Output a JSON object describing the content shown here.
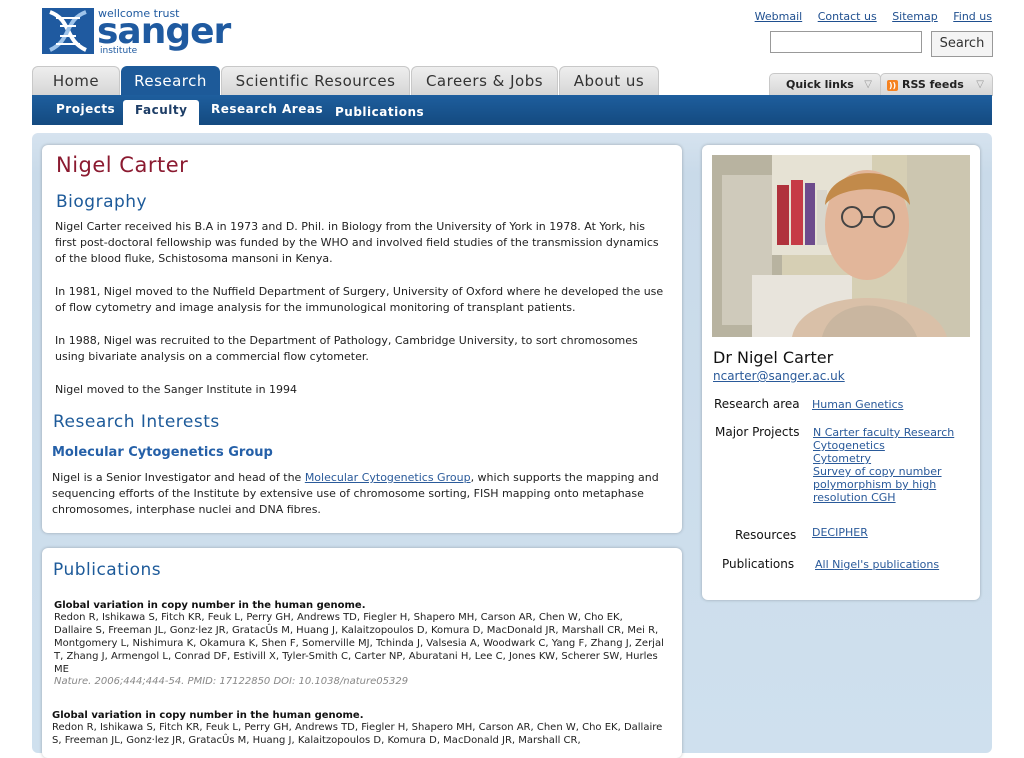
{
  "logo": {
    "trust": "wellcome trust",
    "name": "sanger",
    "institute": "institute"
  },
  "toplinks": [
    "Webmail",
    "Contact us",
    "Sitemap",
    "Find us"
  ],
  "search": {
    "button": "Search",
    "value": ""
  },
  "mainnav": [
    "Home",
    "Research",
    "Scientific Resources",
    "Careers & Jobs",
    "About us"
  ],
  "quick_links": "Quick links",
  "rss": "RSS feeds",
  "subnav": [
    "Projects",
    "Faculty",
    "Research Areas",
    "Publications"
  ],
  "profile": {
    "name": "Nigel Carter",
    "biography_heading": "Biography",
    "bio": [
      "Nigel Carter received his B.A in 1973 and D. Phil. in Biology from the University of York in 1978. At York, his first post-doctoral fellowship was funded by the WHO and involved field studies of the transmission dynamics of the blood fluke, Schistosoma mansoni in Kenya.",
      "In 1981, Nigel moved to the Nuffield Department of Surgery, University of Oxford where he developed the use of flow cytometry and image analysis for the immunological monitoring of transplant patients.",
      "In 1988, Nigel was recruited to the Department of Pathology, Cambridge University, to sort chromosomes using bivariate analysis on a commercial flow cytometer.",
      "Nigel moved to the Sanger Institute in 1994"
    ],
    "research_heading": "Research Interests",
    "group_heading": "Molecular Cytogenetics Group",
    "research_pre": "Nigel is a Senior Investigator and head of the ",
    "research_link": "Molecular Cytogenetics Group",
    "research_post": ", which supports the mapping and sequencing efforts of the Institute by extensive use of chromosome sorting, FISH mapping onto metaphase chromosomes, interphase nuclei and DNA fibres."
  },
  "publications": {
    "heading": "Publications",
    "items": [
      {
        "title": "Global variation in copy number in the human genome.",
        "authors": "Redon R, Ishikawa S, Fitch KR, Feuk L, Perry GH, Andrews TD, Fiegler H, Shapero MH, Carson AR, Chen W, Cho EK, Dallaire S, Freeman JL, Gonz·lez JR, GratacÛs M, Huang J, Kalaitzopoulos D, Komura D, MacDonald JR, Marshall CR, Mei R, Montgomery L, Nishimura K, Okamura K, Shen F, Somerville MJ, Tchinda J, Valsesia A, Woodwark C, Yang F, Zhang J, Zerjal T, Zhang J, Armengol L, Conrad DF, Estivill X, Tyler-Smith C, Carter NP, Aburatani H, Lee C, Jones KW, Scherer SW, Hurles ME",
        "cite": "Nature. 2006;444;444-54. PMID: 17122850 DOI: 10.1038/nature05329"
      },
      {
        "title": "Global variation in copy number in the human genome.",
        "authors": "Redon R, Ishikawa S, Fitch KR, Feuk L, Perry GH, Andrews TD, Fiegler H, Shapero MH, Carson AR, Chen W, Cho EK, Dallaire S, Freeman JL, Gonz·lez JR, GratacÛs M, Huang J, Kalaitzopoulos D, Komura D, MacDonald JR, Marshall CR,"
      }
    ]
  },
  "sidebar": {
    "name": "Dr Nigel Carter",
    "email": "ncarter@sanger.ac.uk",
    "research_area_label": "Research area",
    "research_area": "Human Genetics",
    "major_projects_label": "Major Projects",
    "projects": [
      "N Carter faculty Research",
      "Cytogenetics",
      "Cytometry",
      "Survey of copy number polymorphism by high resolution CGH"
    ],
    "resources_label": "Resources",
    "resources": "DECIPHER",
    "publications_label": "Publications",
    "publications_link": "All Nigel's publications"
  }
}
